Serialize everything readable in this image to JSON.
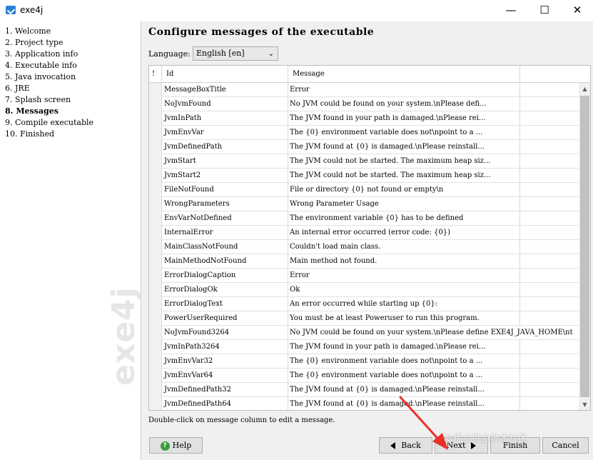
{
  "window": {
    "title": "exe4j"
  },
  "nav": {
    "items": [
      {
        "label": "1. Welcome"
      },
      {
        "label": "2. Project type"
      },
      {
        "label": "3. Application info"
      },
      {
        "label": "4. Executable info"
      },
      {
        "label": "5. Java invocation"
      },
      {
        "label": "6. JRE"
      },
      {
        "label": "7. Splash screen"
      },
      {
        "label": "8. Messages",
        "active": true
      },
      {
        "label": "9. Compile executable"
      },
      {
        "label": "10. Finished"
      }
    ],
    "watermark": "exe4j"
  },
  "main": {
    "title": "Configure messages of the executable",
    "language_label": "Language:",
    "language_value": "English [en]",
    "table": {
      "headers": {
        "flag": "!",
        "id": "Id",
        "message": "Message"
      },
      "rows": [
        {
          "id": "MessageBoxTitle",
          "message": "Error"
        },
        {
          "id": "NoJvmFound",
          "message": "No JVM could be found on your system.\\nPlease defi..."
        },
        {
          "id": "JvmInPath",
          "message": "The JVM found in your path is damaged.\\nPlease rei..."
        },
        {
          "id": "JvmEnvVar",
          "message": "The {0} environment variable does not\\npoint to a ..."
        },
        {
          "id": "JvmDefinedPath",
          "message": "The JVM found at {0} is damaged.\\nPlease reinstall..."
        },
        {
          "id": "JvmStart",
          "message": "The JVM could not be started. The maximum heap siz..."
        },
        {
          "id": "JvmStart2",
          "message": "The JVM could not be started. The maximum heap siz..."
        },
        {
          "id": "FileNotFound",
          "message": "File or directory {0} not found or empty\\n"
        },
        {
          "id": "WrongParameters",
          "message": "Wrong Parameter Usage"
        },
        {
          "id": "EnvVarNotDefined",
          "message": "The environment variable {0} has to be defined"
        },
        {
          "id": "InternalError",
          "message": "An internal error occurred (error code: {0})"
        },
        {
          "id": "MainClassNotFound",
          "message": "Couldn't load main class."
        },
        {
          "id": "MainMethodNotFound",
          "message": "Main method not found."
        },
        {
          "id": "ErrorDialogCaption",
          "message": "Error"
        },
        {
          "id": "ErrorDialogOk",
          "message": "Ok"
        },
        {
          "id": "ErrorDialogText",
          "message": "An error occurred while starting up {0}:"
        },
        {
          "id": "PowerUserRequired",
          "message": "You must be at least Poweruser to run this program."
        },
        {
          "id": "NoJvmFound3264",
          "message": "No JVM could be found on your system.\\nPlease define EXE4J_JAVA_HOME\\nt"
        },
        {
          "id": "JvmInPath3264",
          "message": "The JVM found in your path is damaged.\\nPlease rei..."
        },
        {
          "id": "JvmEnvVar32",
          "message": "The {0} environment variable does not\\npoint to a ..."
        },
        {
          "id": "JvmEnvVar64",
          "message": "The {0} environment variable does not\\npoint to a ..."
        },
        {
          "id": "JvmDefinedPath32",
          "message": "The JVM found at {0} is damaged.\\nPlease reinstall..."
        },
        {
          "id": "JvmDefinedPath64",
          "message": "The JVM found at {0} is damaged.\\nPlease reinstall..."
        }
      ]
    },
    "hint": "Double-click on message column to edit a message."
  },
  "buttons": {
    "help": "Help",
    "back": "Back",
    "next": "Next",
    "finish": "Finish",
    "cancel": "Cancel"
  },
  "overlay": {
    "corner_watermark": "@稀土掘金技术社区",
    "arrow_color": "#e8322b"
  }
}
